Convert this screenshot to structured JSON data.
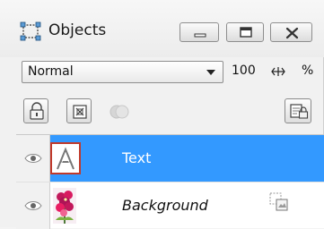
{
  "panel": {
    "title": "Objects",
    "title_icon": "objects-selection-icon",
    "window_buttons": [
      "minimize-icon",
      "maximize-icon",
      "close-icon"
    ]
  },
  "blend": {
    "mode": "Normal",
    "opacity": "100",
    "percent_label": "%"
  },
  "toolbar": {
    "buttons": [
      "lock-icon",
      "mask-icon",
      "merge-icon",
      "object-properties-icon"
    ]
  },
  "layers": [
    {
      "name": "Text",
      "visible": true,
      "selected": true,
      "thumbnail": "text-a-icon"
    },
    {
      "name": "Background",
      "visible": true,
      "selected": false,
      "thumbnail": "flower-photo",
      "type_icon": "image-object-icon"
    }
  ],
  "colors": {
    "selection": "#3399ff",
    "thumb_border": "#c0392b"
  }
}
